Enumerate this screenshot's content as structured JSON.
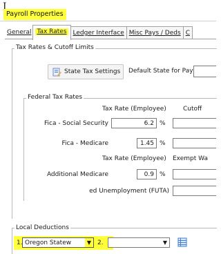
{
  "window": {
    "title": "Payroll Properties"
  },
  "tabs": [
    {
      "label": "General",
      "active": false
    },
    {
      "label": "Tax Rates",
      "active": true
    },
    {
      "label": "Ledger Interface",
      "active": false
    },
    {
      "label": "Misc Pays / Deds",
      "active": false
    },
    {
      "label": "C",
      "active": false
    }
  ],
  "tax_rates_group": {
    "legend": "Tax Rates & Cutoff Limits",
    "state_tax_button": "State Tax Settings",
    "default_state_label": "Default State for Payrol",
    "default_state_value": ""
  },
  "federal_group": {
    "legend": "Federal Tax Rates",
    "header_employee_rate": "Tax Rate (Employee)",
    "header_cutoff": "Cutoff",
    "header_employee_rate_2": "Tax Rate (Employee)",
    "header_exempt": "Exempt Wa",
    "percent_sign": "%",
    "rows": {
      "fica_ss": {
        "label": "Fica - Social Security",
        "rate": "6.2",
        "cutoff": ""
      },
      "fica_medicare": {
        "label": "Fica - Medicare",
        "rate": "1.45",
        "cutoff": ""
      },
      "additional_medicare": {
        "label": "Additional Medicare",
        "rate": "0.9",
        "exempt": ""
      },
      "futa": {
        "label": "ed Unemployment (FUTA)",
        "value": ""
      }
    }
  },
  "local_deductions": {
    "legend": "Local Deductions",
    "slot1_label": "1.",
    "slot1_value": "Oregon Statew",
    "slot2_label": "2.",
    "slot2_value": ""
  },
  "colors": {
    "highlight": "#ffff3b",
    "icon_blue": "#3f7fd6"
  },
  "icons": [
    "text-cursor-icon",
    "state-tax-settings-icon",
    "dropdown-arrow-icon",
    "list-grid-icon"
  ]
}
